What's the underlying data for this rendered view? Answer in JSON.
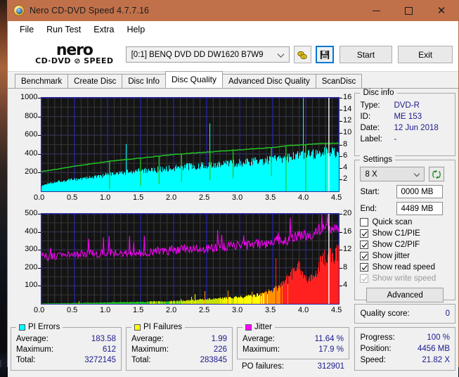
{
  "window": {
    "title": "Nero CD-DVD Speed 4.7.7.16",
    "app_icon": "nero-disc-icon",
    "minimize": "–",
    "maximize": "□",
    "close": "×"
  },
  "menubar": {
    "items": [
      "File",
      "Run Test",
      "Extra",
      "Help"
    ]
  },
  "logo": {
    "line1": "nero",
    "line2": "CD·DVD ⊘ SPEED"
  },
  "toolbar": {
    "drive": "[0:1]   BENQ DVD DD DW1620 B7W9",
    "eject_icon": "disc-eject-icon",
    "save_icon": "floppy-save-icon",
    "start_label": "Start",
    "exit_label": "Exit"
  },
  "tabs": [
    {
      "label": "Benchmark",
      "active": false
    },
    {
      "label": "Create Disc",
      "active": false
    },
    {
      "label": "Disc Info",
      "active": false
    },
    {
      "label": "Disc Quality",
      "active": true
    },
    {
      "label": "Advanced Disc Quality",
      "active": false
    },
    {
      "label": "ScanDisc",
      "active": false
    }
  ],
  "disc_info": {
    "title": "Disc info",
    "type_label": "Type:",
    "type_value": "DVD-R",
    "id_label": "ID:",
    "id_value": "ME 153",
    "date_label": "Date:",
    "date_value": "12 Jun 2018",
    "label_label": "Label:",
    "label_value": "-"
  },
  "settings": {
    "title": "Settings",
    "speed_value": "8 X",
    "refresh_icon": "refresh-recycle-icon",
    "start_label": "Start:",
    "start_value": "0000 MB",
    "end_label": "End:",
    "end_value": "4489 MB",
    "checkboxes": [
      {
        "label": "Quick scan",
        "checked": false,
        "enabled": true
      },
      {
        "label": "Show C1/PIE",
        "checked": true,
        "enabled": true
      },
      {
        "label": "Show C2/PIF",
        "checked": true,
        "enabled": true
      },
      {
        "label": "Show jitter",
        "checked": true,
        "enabled": true
      },
      {
        "label": "Show read speed",
        "checked": true,
        "enabled": true
      },
      {
        "label": "Show write speed",
        "checked": true,
        "enabled": false
      }
    ],
    "advanced_label": "Advanced"
  },
  "quality": {
    "label": "Quality score:",
    "value": "0"
  },
  "progress": {
    "progress_label": "Progress:",
    "progress_value": "100 %",
    "position_label": "Position:",
    "position_value": "4456 MB",
    "speed_label": "Speed:",
    "speed_value": "21.82 X"
  },
  "stats": {
    "pi_errors": {
      "title": "PI Errors",
      "color": "#00ffff",
      "rows": [
        {
          "k": "Average:",
          "v": "183.58"
        },
        {
          "k": "Maximum:",
          "v": "612"
        },
        {
          "k": "Total:",
          "v": "3272145"
        }
      ]
    },
    "pi_failures": {
      "title": "PI Failures",
      "color": "#ffff00",
      "rows": [
        {
          "k": "Average:",
          "v": "1.99"
        },
        {
          "k": "Maximum:",
          "v": "226"
        },
        {
          "k": "Total:",
          "v": "283845"
        }
      ]
    },
    "jitter": {
      "title": "Jitter",
      "color": "#ff00ff",
      "rows": [
        {
          "k": "Average:",
          "v": "11.64 %"
        },
        {
          "k": "Maximum:",
          "v": "17.9 %"
        }
      ],
      "po_label": "PO failures:",
      "po_value": "312901"
    }
  },
  "chart_data": [
    {
      "id": "pi-errors-chart",
      "type": "area",
      "title": "PI Errors / read speed",
      "xlabel": "",
      "ylabel": "PI Errors",
      "xlim": [
        0.0,
        4.5
      ],
      "xticks": [
        "0.0",
        "0.5",
        "1.0",
        "1.5",
        "2.0",
        "2.5",
        "3.0",
        "3.5",
        "4.0",
        "4.5"
      ],
      "ylim": [
        0,
        1000
      ],
      "yticks": [
        "1000",
        "800",
        "600",
        "400",
        "200"
      ],
      "y2lim": [
        0,
        16
      ],
      "y2ticks": [
        "16",
        "14",
        "12",
        "10",
        "8",
        "6",
        "4",
        "2"
      ],
      "grid": true,
      "bg": "#141414",
      "gridcolor": "#2222cc",
      "series": [
        {
          "name": "PI Errors",
          "color": "#00ffff",
          "kind": "area",
          "x": [
            0.0,
            0.09,
            0.18,
            0.27,
            0.36,
            0.45,
            0.54,
            0.63,
            0.72,
            0.81,
            0.9,
            0.99,
            1.08,
            1.17,
            1.26,
            1.35,
            1.44,
            1.53,
            1.62,
            1.71,
            1.8,
            1.89,
            1.98,
            2.07,
            2.16,
            2.25,
            2.34,
            2.43,
            2.52,
            2.61,
            2.7,
            2.79,
            2.88,
            2.97,
            3.06,
            3.15,
            3.24,
            3.33,
            3.42,
            3.51,
            3.6,
            3.69,
            3.78,
            3.87,
            3.96,
            4.05,
            4.14,
            4.23,
            4.32
          ],
          "y": [
            55,
            80,
            95,
            105,
            110,
            118,
            125,
            132,
            140,
            148,
            155,
            168,
            175,
            180,
            192,
            200,
            205,
            208,
            212,
            218,
            225,
            232,
            240,
            244,
            250,
            255,
            258,
            262,
            268,
            272,
            276,
            280,
            285,
            290,
            296,
            300,
            306,
            312,
            318,
            326,
            334,
            342,
            350,
            358,
            366,
            372,
            380,
            392,
            400
          ]
        },
        {
          "name": "Read speed",
          "color": "#22cc22",
          "kind": "line",
          "axis": "y2",
          "x": [
            0.0,
            0.25,
            0.5,
            0.75,
            1.0,
            1.25,
            1.5,
            1.75,
            2.0,
            2.25,
            2.5,
            2.75,
            3.0,
            3.25,
            3.5,
            3.75,
            4.0,
            4.25,
            4.32
          ],
          "y": [
            3.4,
            3.8,
            4.3,
            4.7,
            5.1,
            5.4,
            5.7,
            6.0,
            6.3,
            6.5,
            6.7,
            6.9,
            7.1,
            7.3,
            7.5,
            7.8,
            8.0,
            8.2,
            8.2
          ]
        }
      ]
    },
    {
      "id": "pif-jitter-chart",
      "type": "area",
      "title": "PI Failures / Jitter",
      "xlabel": "",
      "ylabel": "PI Failures",
      "xlim": [
        0.0,
        4.5
      ],
      "xticks": [
        "0.0",
        "0.5",
        "1.0",
        "1.5",
        "2.0",
        "2.5",
        "3.0",
        "3.5",
        "4.0",
        "4.5"
      ],
      "ylim": [
        0,
        500
      ],
      "yticks": [
        "500",
        "400",
        "300",
        "200",
        "100"
      ],
      "y2lim": [
        0,
        20
      ],
      "y2ticks": [
        "20",
        "16",
        "12",
        "8",
        "4"
      ],
      "grid": true,
      "bg": "#141414",
      "gridcolor": "#2222cc",
      "series": [
        {
          "name": "Jitter",
          "color": "#ff00ff",
          "kind": "line",
          "axis": "y2",
          "x": [
            0.0,
            0.09,
            0.18,
            0.27,
            0.36,
            0.45,
            0.54,
            0.63,
            0.72,
            0.81,
            0.9,
            0.99,
            1.08,
            1.17,
            1.26,
            1.35,
            1.44,
            1.53,
            1.62,
            1.71,
            1.8,
            1.89,
            1.98,
            2.07,
            2.16,
            2.25,
            2.34,
            2.43,
            2.52,
            2.61,
            2.7,
            2.79,
            2.88,
            2.97,
            3.06,
            3.15,
            3.24,
            3.33,
            3.42,
            3.51,
            3.6,
            3.69,
            3.78,
            3.87,
            3.96,
            4.05,
            4.14,
            4.23,
            4.32
          ],
          "y": [
            10.8,
            10.2,
            10.6,
            10.9,
            10.7,
            11.0,
            10.9,
            11.1,
            11.2,
            11.0,
            11.3,
            11.2,
            11.4,
            11.2,
            11.5,
            11.3,
            11.1,
            11.4,
            11.3,
            11.6,
            11.8,
            11.7,
            12.0,
            11.9,
            12.2,
            12.1,
            12.4,
            12.3,
            12.2,
            12.5,
            12.8,
            12.6,
            12.9,
            13.0,
            12.7,
            13.2,
            13.4,
            13.1,
            13.6,
            13.9,
            14.2,
            13.8,
            14.5,
            15.0,
            15.4,
            15.1,
            16.2,
            16.8,
            16.5
          ]
        },
        {
          "name": "PI Failures",
          "color": "#ffff00",
          "kind": "area",
          "x": [
            0.0,
            0.09,
            0.18,
            0.27,
            0.36,
            0.45,
            0.54,
            0.63,
            0.72,
            0.81,
            0.9,
            0.99,
            1.08,
            1.17,
            1.26,
            1.35,
            1.44,
            1.53,
            1.62,
            1.71,
            1.8,
            1.89,
            1.98,
            2.07,
            2.16,
            2.25,
            2.34,
            2.43,
            2.52,
            2.61,
            2.7,
            2.79,
            2.88,
            2.97,
            3.06,
            3.15,
            3.24,
            3.33,
            3.42,
            3.51,
            3.6,
            3.69,
            3.78,
            3.87,
            3.96,
            4.05,
            4.14,
            4.23,
            4.32
          ],
          "y": [
            2,
            2,
            3,
            3,
            4,
            4,
            5,
            5,
            6,
            6,
            7,
            7,
            8,
            8,
            9,
            9,
            10,
            10,
            11,
            12,
            12,
            13,
            14,
            15,
            16,
            18,
            20,
            22,
            24,
            26,
            28,
            30,
            32,
            34,
            36,
            40,
            44,
            50,
            60,
            72,
            90,
            110,
            150,
            200,
            170,
            120,
            150,
            210,
            260
          ]
        }
      ]
    }
  ]
}
